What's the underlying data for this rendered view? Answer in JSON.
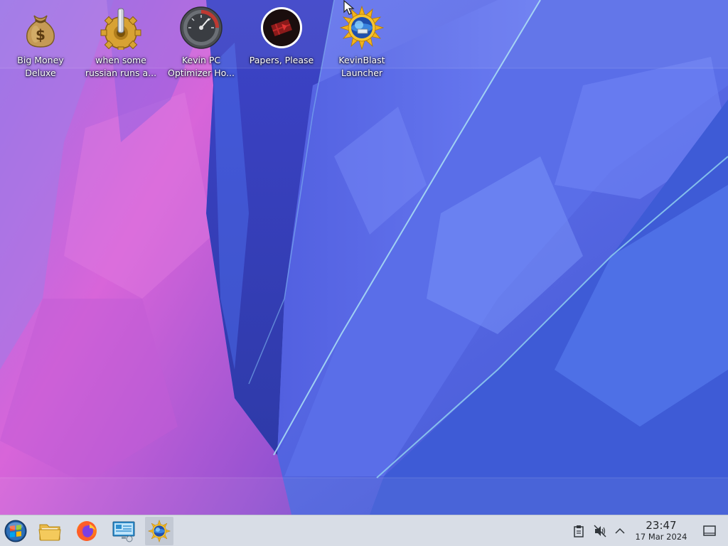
{
  "desktop": {
    "icons": [
      {
        "label": "Big Money\nDeluxe",
        "icon": "money-bag-icon"
      },
      {
        "label": "when some\nrussian runs a...",
        "icon": "gear-lever-icon"
      },
      {
        "label": "Kevin PC\nOptimizer Ho...",
        "icon": "speedometer-icon"
      },
      {
        "label": "Papers, Please",
        "icon": "papers-please-emblem-icon"
      },
      {
        "label": "KevinBlast\nLauncher",
        "icon": "kevinblast-sun-icon"
      }
    ]
  },
  "taskbar": {
    "launchers": [
      {
        "name": "start-menu-button",
        "icon": "windows-orb-icon"
      },
      {
        "name": "file-manager-button",
        "icon": "folder-icon"
      },
      {
        "name": "firefox-button",
        "icon": "firefox-icon"
      },
      {
        "name": "remote-desktop-button",
        "icon": "monitor-network-icon"
      },
      {
        "name": "kevinblast-task-button",
        "icon": "kevinblast-sun-icon",
        "active": true
      }
    ],
    "tray": {
      "icons": [
        "clipboard-icon",
        "volume-muted-icon",
        "chevron-up-icon"
      ]
    },
    "clock": {
      "time": "23:47",
      "date": "17 Mar 2024"
    },
    "show_desktop_icon": "show-desktop-icon"
  },
  "colors": {
    "taskbar_bg": "#d8dde6",
    "wallpaper_pink": "#c85ad6",
    "wallpaper_blue": "#4e5ad8",
    "label_text": "#ffffff"
  }
}
